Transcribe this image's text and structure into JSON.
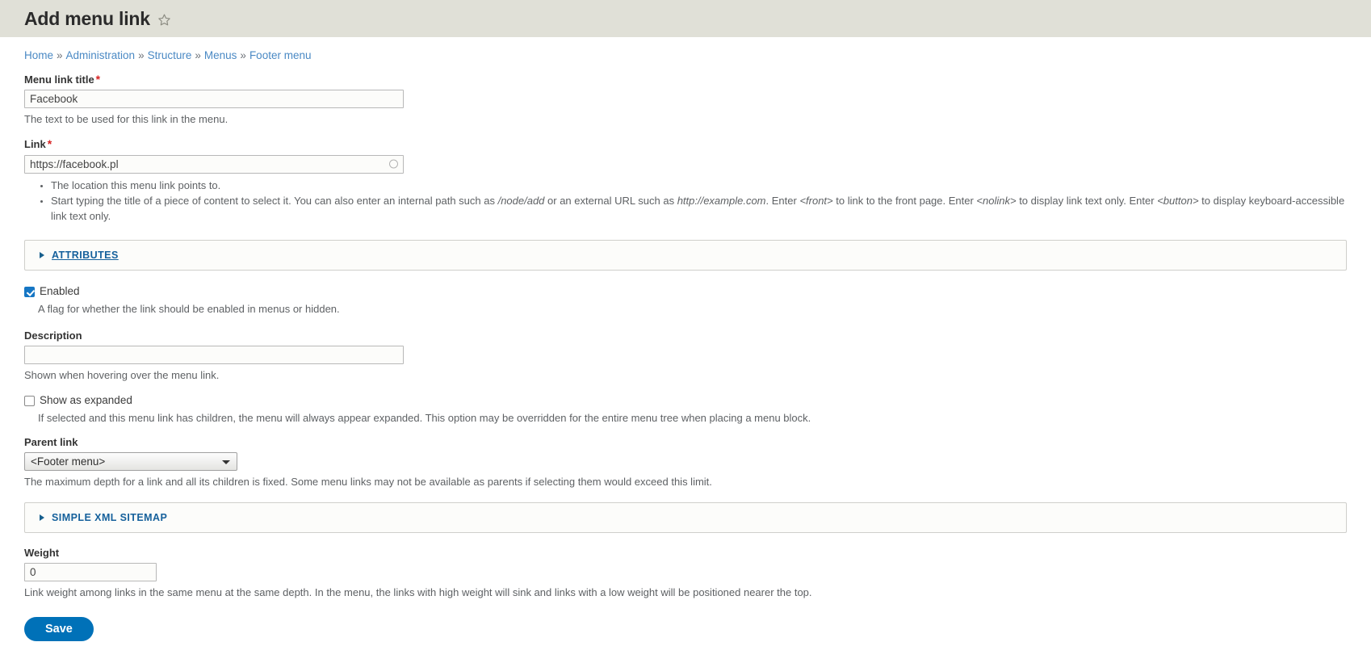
{
  "header": {
    "title": "Add menu link",
    "star_icon": "star-outline-icon"
  },
  "breadcrumb": {
    "separator": "»",
    "items": [
      {
        "label": "Home"
      },
      {
        "label": "Administration"
      },
      {
        "label": "Structure"
      },
      {
        "label": "Menus"
      },
      {
        "label": "Footer menu"
      }
    ]
  },
  "form": {
    "menu_link_title": {
      "label": "Menu link title",
      "required_mark": "*",
      "value": "Facebook",
      "description": "The text to be used for this link in the menu."
    },
    "link": {
      "label": "Link",
      "required_mark": "*",
      "value": "https://facebook.pl",
      "throbber_icon": "loading-circle-icon",
      "descriptions": {
        "first": "The location this menu link points to.",
        "second_parts": {
          "p1": "Start typing the title of a piece of content to select it. You can also enter an internal path such as ",
          "i1": "/node/add",
          "p2": " or an external URL such as ",
          "i2": "http://example.com",
          "p3": ". Enter ",
          "i3": "<front>",
          "p4": " to link to the front page. Enter ",
          "i4": "<nolink>",
          "p5": " to display link text only. Enter ",
          "i5": "<button>",
          "p6": " to display keyboard-accessible link text only."
        }
      }
    },
    "attributes_details": {
      "summary": "Attributes",
      "marker": "collapsed-triangle-icon"
    },
    "enabled": {
      "label": "Enabled",
      "checked": true,
      "description": "A flag for whether the link should be enabled in menus or hidden."
    },
    "description_field": {
      "label": "Description",
      "value": "",
      "description": "Shown when hovering over the menu link."
    },
    "show_as_expanded": {
      "label": "Show as expanded",
      "checked": false,
      "description": "If selected and this menu link has children, the menu will always appear expanded. This option may be overridden for the entire menu tree when placing a menu block."
    },
    "parent_link": {
      "label": "Parent link",
      "selected": "<Footer menu>",
      "options": [
        "<Footer menu>"
      ],
      "description": "The maximum depth for a link and all its children is fixed. Some menu links may not be available as parents if selecting them would exceed this limit."
    },
    "sitemap_details": {
      "summary": "Simple XML sitemap",
      "marker": "collapsed-triangle-icon"
    },
    "weight": {
      "label": "Weight",
      "value": "0",
      "description": "Link weight among links in the same menu at the same depth. In the menu, the links with high weight will sink and links with a low weight will be positioned nearer the top."
    },
    "save_button": {
      "label": "Save"
    }
  },
  "colors": {
    "header_bg": "#e0e0d7",
    "link_blue": "#4a89c4",
    "details_blue": "#16619c",
    "required_red": "#d72222",
    "primary_button": "#0071b8",
    "checkbox_checked": "#1676c4"
  }
}
